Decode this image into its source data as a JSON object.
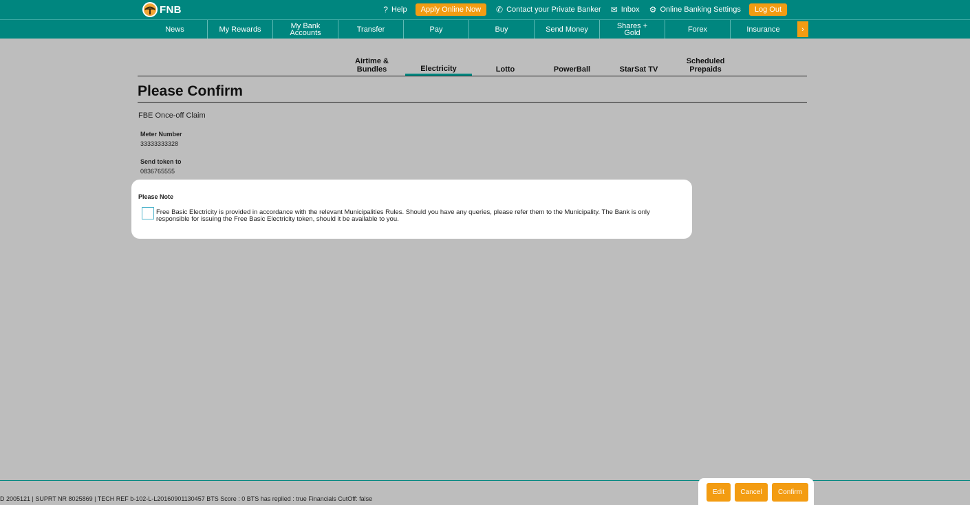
{
  "brand": {
    "name": "FNB"
  },
  "topbar": {
    "help": "Help",
    "apply": "Apply Online Now",
    "contact": "Contact your Private Banker",
    "inbox": "Inbox",
    "settings": "Online Banking Settings",
    "logout": "Log Out"
  },
  "mainnav": {
    "items": [
      "News",
      "My Rewards",
      "My Bank\nAccounts",
      "Transfer",
      "Pay",
      "Buy",
      "Send Money",
      "Shares +\nGold",
      "Forex",
      "Insurance"
    ],
    "more": "›"
  },
  "subtabs": {
    "items": [
      "Airtime &\nBundles",
      "Electricity",
      "Lotto",
      "PowerBall",
      "StarSat TV",
      "Scheduled\nPrepaids"
    ],
    "active_index": 1
  },
  "page": {
    "title": "Please Confirm",
    "subheading": "FBE Once-off Claim",
    "meter_label": "Meter Number",
    "meter_value": "33333333328",
    "token_label": "Send token to",
    "token_value": "0836765555"
  },
  "note": {
    "title": "Please Note",
    "text": "Free Basic Electricity is provided in accordance with the relevant Municipalities Rules. Should you have any queries, please refer them to the Municipality. The Bank is only responsible for issuing the Free Basic Electricity token, should it be available to you.",
    "checked": false
  },
  "footer": {
    "info": "D 2005121 | SUPRT NR 8025869 | TECH REF b-102-L-L20160901130457 BTS Score : 0 BTS has replied : true Financials CutOff: false",
    "edit": "Edit",
    "cancel": "Cancel",
    "confirm": "Confirm"
  },
  "colors": {
    "brand_teal": "#00867f",
    "accent_orange": "#f39c12",
    "page_bg": "#bdbdbd"
  }
}
